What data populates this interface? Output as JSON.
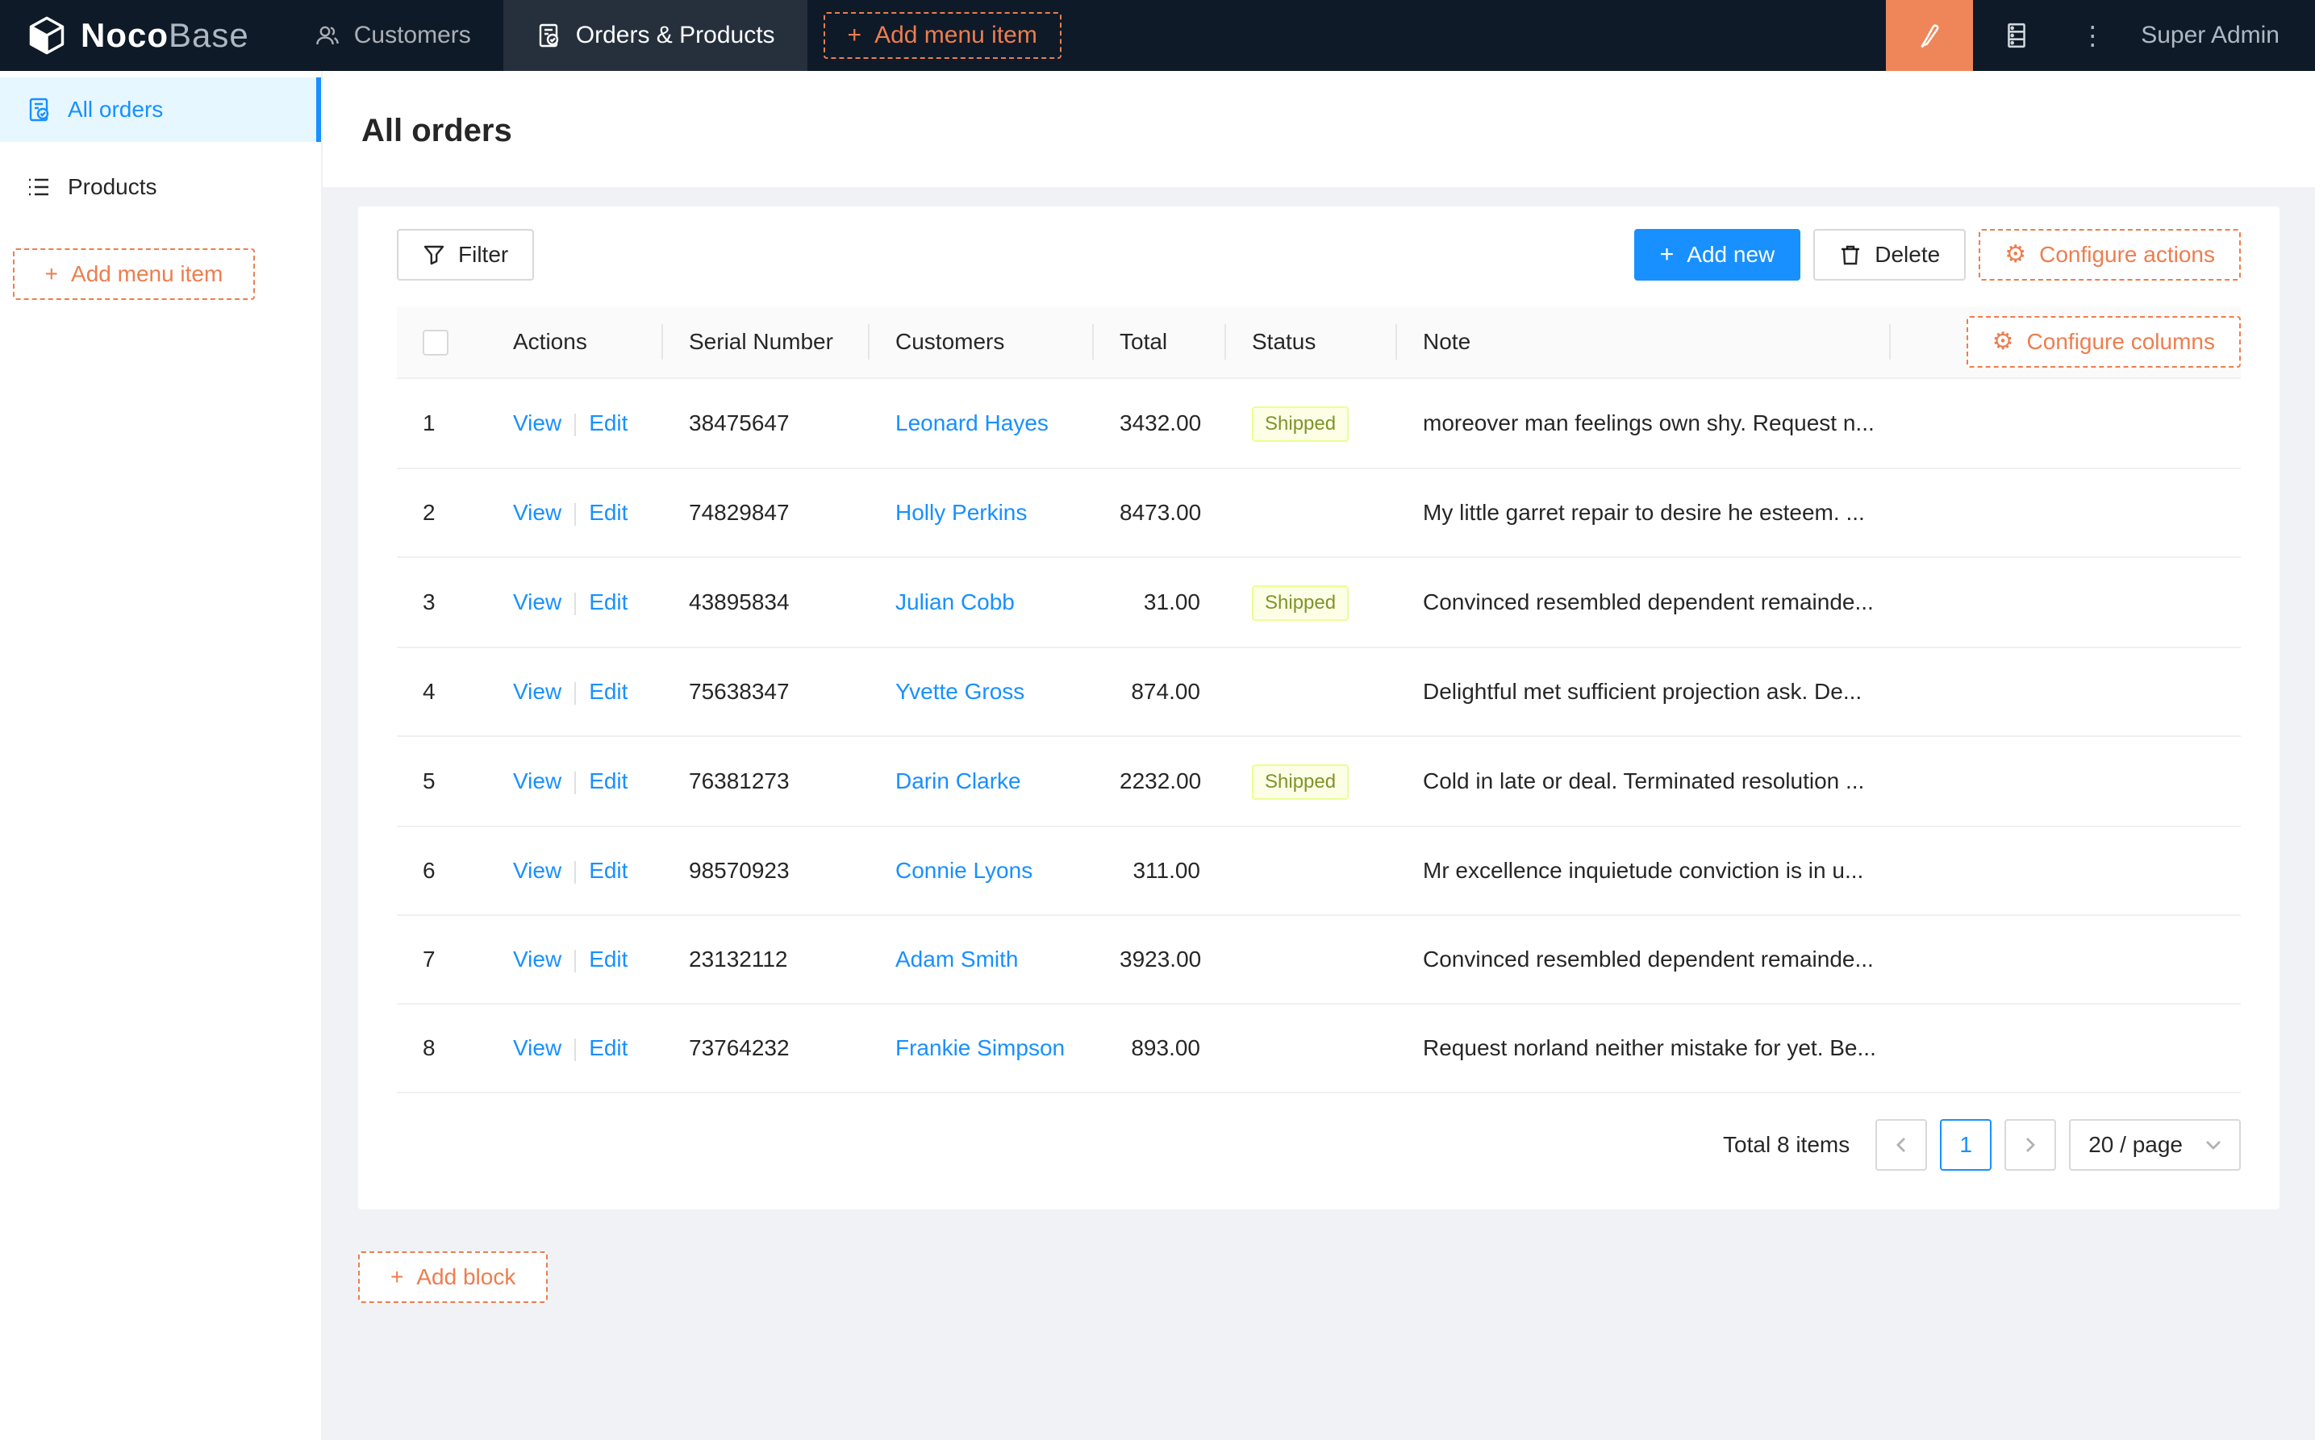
{
  "topbar": {
    "logo": {
      "noco": "Noco",
      "base": "Base"
    },
    "nav": [
      {
        "label": "Customers",
        "active": false
      },
      {
        "label": "Orders & Products",
        "active": true
      }
    ],
    "add_menu_item_label": "Add menu item",
    "user": "Super Admin",
    "ellipsis_glyph": "⋮"
  },
  "sidebar": {
    "items": [
      {
        "label": "All orders",
        "active": true
      },
      {
        "label": "Products",
        "active": false
      }
    ],
    "add_menu_item_label": "Add menu item"
  },
  "page": {
    "title": "All orders"
  },
  "toolbar": {
    "filter_label": "Filter",
    "add_new_label": "Add new",
    "delete_label": "Delete",
    "configure_actions_label": "Configure actions",
    "plus_glyph": "+",
    "gear_glyph": "⚙"
  },
  "table": {
    "columns": [
      "Actions",
      "Serial Number",
      "Customers",
      "Total",
      "Status",
      "Note"
    ],
    "configure_columns_label": "Configure columns",
    "view_label": "View",
    "edit_label": "Edit",
    "rows": [
      {
        "index": "1",
        "serial": "38475647",
        "customer": "Leonard Hayes",
        "total": "3432.00",
        "status": "Shipped",
        "note": "moreover man feelings own shy. Request n..."
      },
      {
        "index": "2",
        "serial": "74829847",
        "customer": "Holly Perkins",
        "total": "8473.00",
        "status": "",
        "note": "My little garret repair to desire he esteem. ..."
      },
      {
        "index": "3",
        "serial": "43895834",
        "customer": "Julian Cobb",
        "total": "31.00",
        "status": "Shipped",
        "note": "Convinced resembled dependent remainde..."
      },
      {
        "index": "4",
        "serial": "75638347",
        "customer": "Yvette Gross",
        "total": "874.00",
        "status": "",
        "note": "Delightful met sufficient projection ask. De..."
      },
      {
        "index": "5",
        "serial": "76381273",
        "customer": "Darin Clarke",
        "total": "2232.00",
        "status": "Shipped",
        "note": "Cold in late or deal. Terminated resolution ..."
      },
      {
        "index": "6",
        "serial": "98570923",
        "customer": "Connie Lyons",
        "total": "311.00",
        "status": "",
        "note": "Mr excellence inquietude conviction is in u..."
      },
      {
        "index": "7",
        "serial": "23132112",
        "customer": "Adam Smith",
        "total": "3923.00",
        "status": "",
        "note": "Convinced resembled dependent remainde..."
      },
      {
        "index": "8",
        "serial": "73764232",
        "customer": "Frankie Simpson",
        "total": "893.00",
        "status": "",
        "note": "Request norland neither mistake for yet. Be..."
      }
    ]
  },
  "pagination": {
    "total_text": "Total 8 items",
    "current_page": "1",
    "page_size_text": "20 / page"
  },
  "add_block_label": "Add block",
  "colors": {
    "accent_blue": "#1890ff",
    "designer_orange": "#ee7d4e",
    "header_bg": "#0e1a28",
    "selected_menu_bg": "#e6f7ff",
    "tag_shipped_bg": "#fcffe6",
    "tag_shipped_border": "#eaff8f",
    "tag_shipped_text": "#7f942a",
    "content_bg": "#f0f2f5"
  }
}
